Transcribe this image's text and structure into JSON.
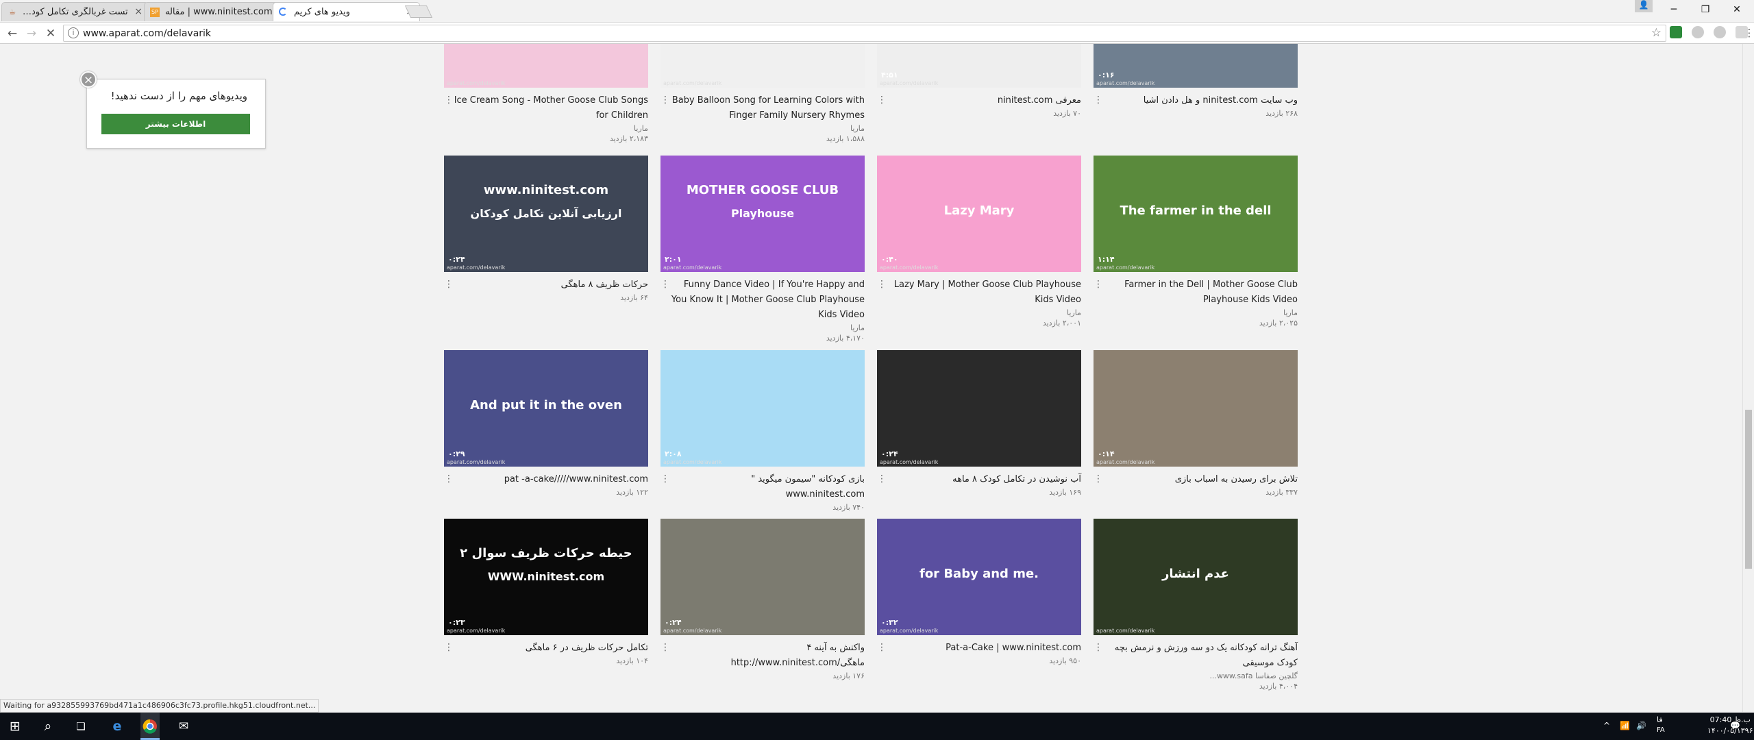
{
  "browser": {
    "tabs": [
      {
        "title": "تست غربالگری تکامل کود…",
        "favicon": "ninitest-favicon",
        "active": false
      },
      {
        "title": "www.ninitest.com | مقاله",
        "favicon": "site-favicon",
        "active": false
      },
      {
        "title": "ویدیو های کریم",
        "favicon": "loading-spinner",
        "active": true
      }
    ],
    "url": "www.aparat.com/delavarik",
    "status_text": "Waiting for a932855993769bd471a1c486906c3fc73.profile.hkg51.cloudfront.net..."
  },
  "popup": {
    "text": "ویدیوهای مهم را از دست ندهید!",
    "button_label": "اطلاعات بیشتر"
  },
  "videos": [
    {
      "row": 0,
      "col": 0,
      "title": "Ice Cream Song - Mother Goose Club Songs for Children",
      "channel": "ماریا",
      "views": "۲،۱۸۳ بازدید",
      "duration": "",
      "thumb_color": "#f3c7dc"
    },
    {
      "row": 0,
      "col": 1,
      "title": "Baby Balloon Song for Learning Colors with Finger Family Nursery Rhymes",
      "channel": "ماریا",
      "views": "۱،۵۸۸ بازدید",
      "duration": "",
      "thumb_color": "#f0f0f0"
    },
    {
      "row": 0,
      "col": 2,
      "title": "معرفی ninitest.com",
      "channel": "",
      "views": "۷۰ بازدید",
      "duration": "۴:۵۱",
      "thumb_color": "#eeeeee"
    },
    {
      "row": 0,
      "col": 3,
      "title": "وب سایت ninitest.com و هل دادن اشیا",
      "channel": "",
      "views": "۲۶۸ بازدید",
      "duration": "۰:۱۶",
      "thumb_color": "#6f7f90"
    },
    {
      "row": 1,
      "col": 0,
      "title": "حرکات ظریف ۸ ماهگی",
      "channel": "",
      "views": "۶۴ بازدید",
      "duration": "۰:۲۴",
      "thumb_color": "#3e4656",
      "overlay1": "www.ninitest.com",
      "overlay2": "ارزیابی آنلاین تکامل کودکان"
    },
    {
      "row": 1,
      "col": 1,
      "title": "Funny Dance Video | If You're Happy and You Know It | Mother Goose Club Playhouse Kids Video",
      "channel": "ماریا",
      "views": "۴،۱۷۰ بازدید",
      "duration": "۲:۰۱",
      "thumb_color": "#9b59d0",
      "overlay1": "MOTHER GOOSE CLUB",
      "overlay2": "Playhouse"
    },
    {
      "row": 1,
      "col": 2,
      "title": "Lazy Mary | Mother Goose Club Playhouse Kids Video",
      "channel": "ماریا",
      "views": "۲،۰۰۱ بازدید",
      "duration": "۰:۴۰",
      "thumb_color": "#f7a1cf",
      "overlay1": "Lazy Mary"
    },
    {
      "row": 1,
      "col": 3,
      "title": "Farmer in the Dell | Mother Goose Club Playhouse Kids Video",
      "channel": "ماریا",
      "views": "۲،۰۲۵ بازدید",
      "duration": "۱:۱۴",
      "thumb_color": "#5a8a3c",
      "overlay1": "The farmer in the dell"
    },
    {
      "row": 2,
      "col": 0,
      "title": "pat -a-cake/////www.ninitest.com",
      "channel": "",
      "views": "۱۲۲ بازدید",
      "duration": "۰:۲۹",
      "thumb_color": "#4a4f8a",
      "overlay1": "And put it in the oven"
    },
    {
      "row": 2,
      "col": 1,
      "title": "بازی کودکانه \"سیمون میگوید \" www.ninitest.com",
      "channel": "",
      "views": "۷۴۰ بازدید",
      "duration": "۲:۰۸",
      "thumb_color": "#a9dcf5"
    },
    {
      "row": 2,
      "col": 2,
      "title": "آب نوشیدن در تکامل کودک ۸ ماهه",
      "channel": "",
      "views": "۱۶۹ بازدید",
      "duration": "۰:۲۴",
      "thumb_color": "#2a2a2a"
    },
    {
      "row": 2,
      "col": 3,
      "title": "تلاش برای رسیدن به اسباب بازی",
      "channel": "",
      "views": "۳۳۷ بازدید",
      "duration": "۰:۱۴",
      "thumb_color": "#8c8070"
    },
    {
      "row": 3,
      "col": 0,
      "title": "تکامل حرکات ظریف در ۶ ماهگی",
      "channel": "",
      "views": "۱۰۴ بازدید",
      "duration": "۰:۲۳",
      "thumb_color": "#0a0a0a",
      "overlay1": "حیطه حرکات ظریف سوال ۲",
      "overlay2": "WWW.ninitest.com"
    },
    {
      "row": 3,
      "col": 1,
      "title": "واکنش به آینه ۴ ماهگی/http://www.ninitest.com",
      "channel": "",
      "views": "۱۷۶ بازدید",
      "duration": "۰:۲۴",
      "thumb_color": "#7c7b70"
    },
    {
      "row": 3,
      "col": 2,
      "title": "Pat-a-Cake | www.ninitest.com",
      "channel": "",
      "views": "۹۵۰ بازدید",
      "duration": "۰:۳۲",
      "thumb_color": "#5a4fa0",
      "overlay1": "for Baby and me."
    },
    {
      "row": 3,
      "col": 3,
      "title": "آهنگ ترانه کودکانه یک دو سه ورزش و نرمش بچه کودک موسیقی",
      "channel": "گلچین صفاسا www.safa...",
      "views": "۴،۰۰۴ بازدید",
      "duration": "",
      "thumb_color": "#2e3a24",
      "overlay1": "عدم انتشار"
    }
  ],
  "taskbar": {
    "language": "FA",
    "lang_label": "فا",
    "time": "07:40 ب.ظ",
    "date": "۱۴۰۰/۰۵/۱۳۹۶"
  }
}
